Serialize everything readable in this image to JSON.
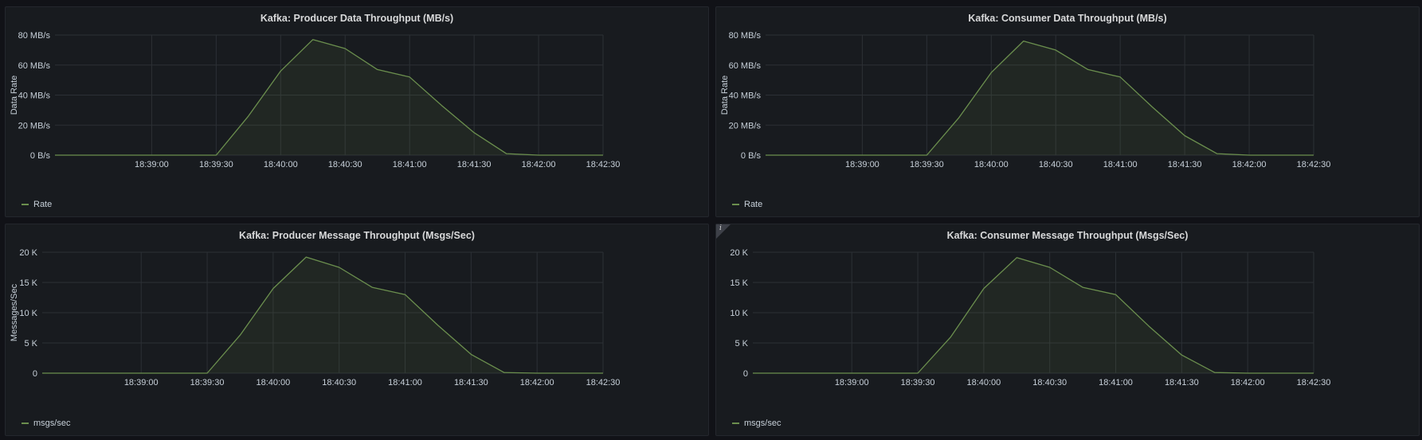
{
  "colors": {
    "series": "#6b8f4e",
    "fill": "rgba(115,150,80,0.10)",
    "grid": "#2c3035",
    "text": "#c7d0d9"
  },
  "x_tick_labels": [
    "18:39:00",
    "18:39:30",
    "18:40:00",
    "18:40:30",
    "18:41:00",
    "18:41:30",
    "18:42:00",
    "18:42:30"
  ],
  "chart_data": [
    {
      "type": "area",
      "title": "Kafka: Producer Data Throughput (MB/s)",
      "ylabel": "Data Rate",
      "series": [
        {
          "name": "Rate",
          "x": [
            "18:38:15",
            "18:39:30",
            "18:39:45",
            "18:40:00",
            "18:40:15",
            "18:40:30",
            "18:40:45",
            "18:41:00",
            "18:41:15",
            "18:41:30",
            "18:41:45",
            "18:42:00",
            "18:42:30"
          ],
          "values": [
            0,
            0,
            26,
            56,
            77,
            71,
            57,
            52,
            33,
            15,
            1,
            0,
            0
          ]
        }
      ],
      "ylim": [
        0,
        80
      ],
      "y_tick_labels": [
        "0 B/s",
        "20 MB/s",
        "40 MB/s",
        "60 MB/s",
        "80 MB/s"
      ],
      "grid": true,
      "legend_position": "bottom-left"
    },
    {
      "type": "area",
      "title": "Kafka: Consumer Data Throughput (MB/s)",
      "ylabel": "Data Rate",
      "series": [
        {
          "name": "Rate",
          "x": [
            "18:38:15",
            "18:39:30",
            "18:39:45",
            "18:40:00",
            "18:40:15",
            "18:40:30",
            "18:40:45",
            "18:41:00",
            "18:41:15",
            "18:41:30",
            "18:41:45",
            "18:42:00",
            "18:42:30"
          ],
          "values": [
            0,
            0,
            25,
            55,
            76,
            70,
            57,
            52,
            32,
            13,
            1,
            0,
            0
          ]
        }
      ],
      "ylim": [
        0,
        80
      ],
      "y_tick_labels": [
        "0 B/s",
        "20 MB/s",
        "40 MB/s",
        "60 MB/s",
        "80 MB/s"
      ],
      "grid": true,
      "legend_position": "bottom-left"
    },
    {
      "type": "area",
      "title": "Kafka: Producer Message Throughput (Msgs/Sec)",
      "ylabel": "Messages/Sec",
      "series": [
        {
          "name": "msgs/sec",
          "x": [
            "18:38:15",
            "18:39:30",
            "18:39:45",
            "18:40:00",
            "18:40:15",
            "18:40:30",
            "18:40:45",
            "18:41:00",
            "18:41:15",
            "18:41:30",
            "18:41:45",
            "18:42:00",
            "18:42:30"
          ],
          "values": [
            0,
            0,
            6300,
            14000,
            19200,
            17500,
            14200,
            13000,
            7900,
            3100,
            100,
            0,
            0
          ]
        }
      ],
      "ylim": [
        0,
        20000
      ],
      "y_tick_labels": [
        "0",
        "5 K",
        "10 K",
        "15 K",
        "20 K"
      ],
      "grid": true,
      "legend_position": "bottom-left"
    },
    {
      "type": "area",
      "title": "Kafka: Consumer Message Throughput (Msgs/Sec)",
      "ylabel": "",
      "info_icon": "info-icon",
      "series": [
        {
          "name": "msgs/sec",
          "x": [
            "18:38:15",
            "18:39:30",
            "18:39:45",
            "18:40:00",
            "18:40:15",
            "18:40:30",
            "18:40:45",
            "18:41:00",
            "18:41:15",
            "18:41:30",
            "18:41:45",
            "18:42:00",
            "18:42:30"
          ],
          "values": [
            0,
            0,
            6000,
            14000,
            19100,
            17500,
            14200,
            13000,
            7800,
            3000,
            100,
            0,
            0
          ]
        }
      ],
      "ylim": [
        0,
        20000
      ],
      "y_tick_labels": [
        "0",
        "5 K",
        "10 K",
        "15 K",
        "20 K"
      ],
      "grid": true,
      "legend_position": "bottom-left"
    }
  ]
}
